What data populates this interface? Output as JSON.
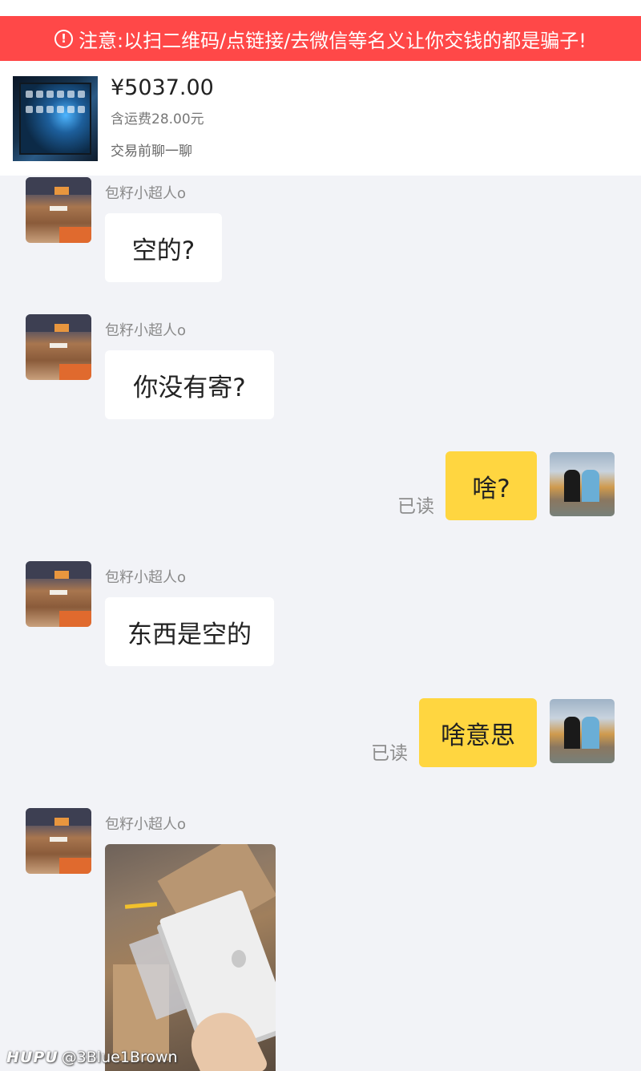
{
  "warning": {
    "icon": "alert-circle-icon",
    "text": "注意:以扫二维码/点链接/去微信等名义让你交钱的都是骗子!"
  },
  "product": {
    "price": "¥5037.00",
    "shipping": "含运费28.00元",
    "note": "交易前聊一聊"
  },
  "messages": [
    {
      "side": "left",
      "sender": "包籽小超人o",
      "text": "空的?"
    },
    {
      "side": "left",
      "sender": "包籽小超人o",
      "text": "你没有寄?"
    },
    {
      "side": "right",
      "text": "啥?",
      "status": "已读"
    },
    {
      "side": "left",
      "sender": "包籽小超人o",
      "text": "东西是空的"
    },
    {
      "side": "right",
      "text": "啥意思",
      "status": "已读"
    },
    {
      "side": "left",
      "sender": "包籽小超人o",
      "attachment": "photo"
    }
  ],
  "watermark": {
    "brand": "HUPU",
    "handle": "@3Blue1Brown"
  },
  "colors": {
    "warning_bg": "#ff4848",
    "bubble_self": "#ffd640",
    "bubble_other": "#ffffff",
    "chat_bg": "#f2f3f7"
  }
}
